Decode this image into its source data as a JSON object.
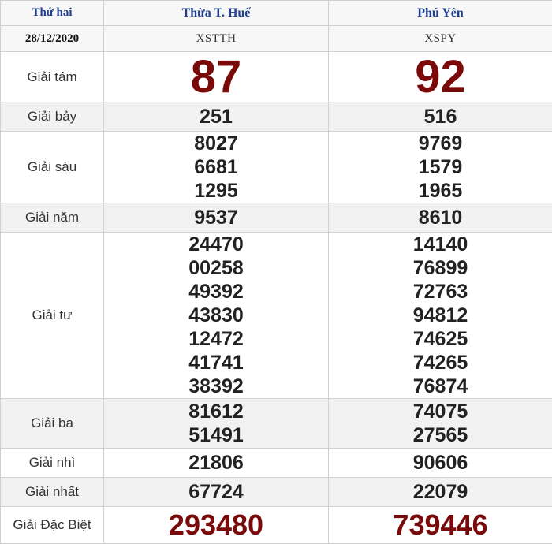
{
  "header": {
    "day": "Thứ hai",
    "date": "28/12/2020",
    "provinces": [
      {
        "name": "Thừa T. Huế",
        "code": "XSTTH"
      },
      {
        "name": "Phú Yên",
        "code": "XSPY"
      }
    ]
  },
  "prizes": {
    "g8": {
      "label": "Giải tám",
      "values": [
        [
          "87"
        ],
        [
          "92"
        ]
      ]
    },
    "g7": {
      "label": "Giải bảy",
      "values": [
        [
          "251"
        ],
        [
          "516"
        ]
      ]
    },
    "g6": {
      "label": "Giải sáu",
      "values": [
        [
          "8027",
          "6681",
          "1295"
        ],
        [
          "9769",
          "1579",
          "1965"
        ]
      ]
    },
    "g5": {
      "label": "Giải năm",
      "values": [
        [
          "9537"
        ],
        [
          "8610"
        ]
      ]
    },
    "g4": {
      "label": "Giải tư",
      "values": [
        [
          "24470",
          "00258",
          "49392",
          "43830",
          "12472",
          "41741",
          "38392"
        ],
        [
          "14140",
          "76899",
          "72763",
          "94812",
          "74625",
          "74265",
          "76874"
        ]
      ]
    },
    "g3": {
      "label": "Giải ba",
      "values": [
        [
          "81612",
          "51491"
        ],
        [
          "74075",
          "27565"
        ]
      ]
    },
    "g2": {
      "label": "Giải nhì",
      "values": [
        [
          "21806"
        ],
        [
          "90606"
        ]
      ]
    },
    "g1": {
      "label": "Giải nhất",
      "values": [
        [
          "67724"
        ],
        [
          "22079"
        ]
      ]
    },
    "gdb": {
      "label": "Giải Đặc Biệt",
      "values": [
        [
          "293480"
        ],
        [
          "739446"
        ]
      ]
    }
  },
  "colors": {
    "header_text": "#1f3f8f",
    "highlight": "#7a0a0a",
    "text": "#222222"
  }
}
